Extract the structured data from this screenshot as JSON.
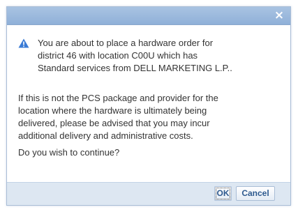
{
  "dialog": {
    "close_glyph": "×",
    "warning_lines": [
      "You are about to place a hardware order for",
      "district 46 with location C00U which has",
      "Standard services from DELL MARKETING L.P.."
    ],
    "info_lines": [
      "If this is not the PCS package and provider for the",
      "location where the hardware is ultimately being",
      "delivered, please be advised that you may incur",
      "additional delivery and administrative costs."
    ],
    "question": "Do you wish to continue?",
    "buttons": {
      "ok_label": "OK",
      "cancel_label": "Cancel"
    },
    "icons": {
      "warning": "warning-triangle-icon",
      "close": "close-icon"
    },
    "colors": {
      "titlebar": "#9cb9de",
      "footer": "#dde7f2",
      "warning_icon": "#3a7bd5",
      "button_text": "#2e5a8f"
    }
  }
}
